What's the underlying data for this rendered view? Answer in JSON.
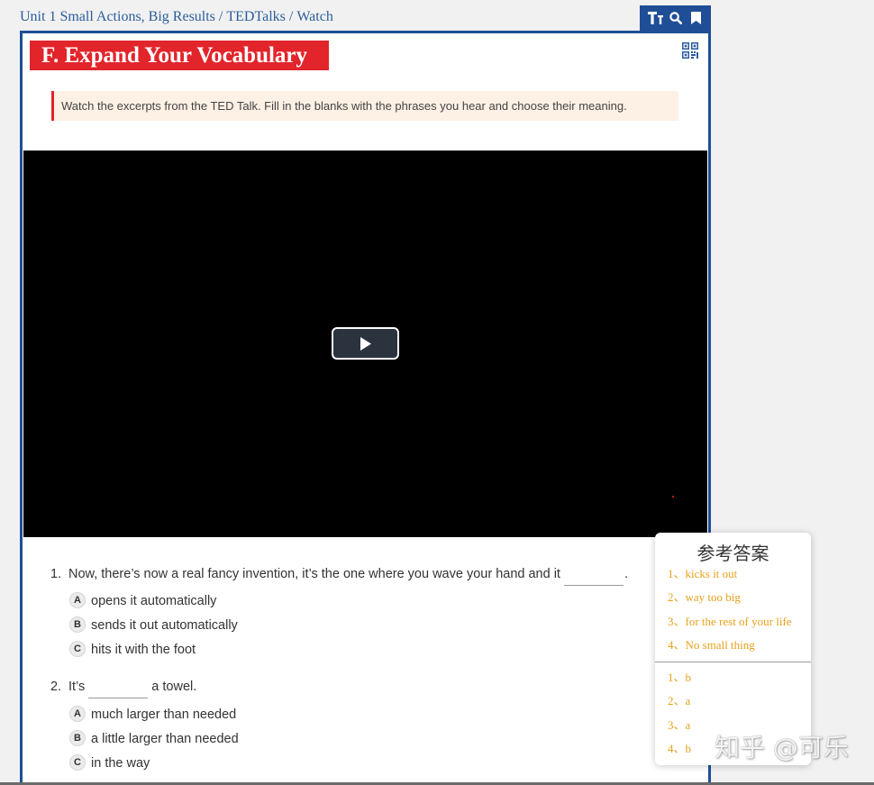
{
  "breadcrumb": {
    "items": [
      "Unit 1 Small Actions, Big Results",
      "TEDTalks",
      "Watch"
    ],
    "separator": "/"
  },
  "toolbar": {
    "icons": [
      "text-size-icon",
      "search-icon",
      "bookmark-icon"
    ]
  },
  "section": {
    "title": "F. Expand Your Vocabulary",
    "qr_icon": "qr-code-icon",
    "instruction": "Watch the excerpts from the TED Talk. Fill in the blanks with the phrases you hear and choose their meaning."
  },
  "video": {
    "play_icon": "play-icon"
  },
  "questions": [
    {
      "number": "1.",
      "before": "Now, there’s now a real fancy invention, it’s the one where you wave your hand and it",
      "after": ".",
      "options": [
        {
          "letter": "A",
          "text": "opens it automatically"
        },
        {
          "letter": "B",
          "text": "sends it out automatically"
        },
        {
          "letter": "C",
          "text": "hits it with the foot"
        }
      ]
    },
    {
      "number": "2.",
      "before": "It’s",
      "after": "a towel.",
      "options": [
        {
          "letter": "A",
          "text": "much larger than needed"
        },
        {
          "letter": "B",
          "text": "a little larger than needed"
        },
        {
          "letter": "C",
          "text": "in the way"
        }
      ]
    }
  ],
  "answer_popup": {
    "title": "参考答案",
    "phrases": [
      "1、kicks it out",
      "2、way too big",
      "3、for the rest of your life",
      "4、No small thing"
    ],
    "choices": [
      "1、b",
      "2、a",
      "3、a",
      "4、b"
    ]
  },
  "watermark": "知乎 @可乐",
  "colors": {
    "frame_blue": "#1f4e96",
    "breadcrumb_blue": "#2b5e9c",
    "title_red": "#e2242b",
    "instruction_bg": "#fdf0e4",
    "answer_gold": "#e8a11a"
  }
}
